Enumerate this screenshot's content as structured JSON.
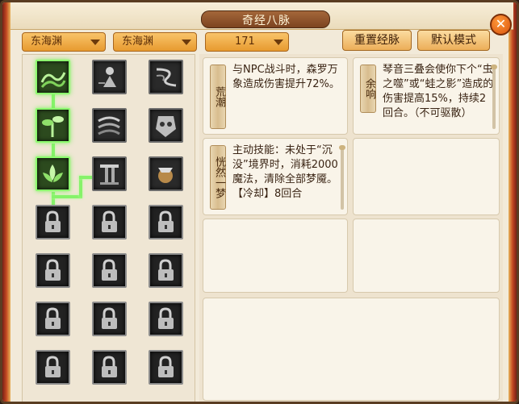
{
  "window": {
    "title": "奇经八脉"
  },
  "controls": {
    "dropdown1": "东海渊",
    "dropdown2": "东海渊",
    "dropdown3": "171",
    "reset_button": "重置经脉",
    "default_button": "默认模式",
    "close_icon": "close-icon"
  },
  "skills": [
    {
      "name": "荒潮",
      "desc": "与NPC战斗时，森罗万象造成伤害提升72%。"
    },
    {
      "name": "余响",
      "desc": "琴音三叠会使你下个“虫之噬”或“蛙之影”造成的伤害提高15%，持续2回合。（不可驱散）"
    },
    {
      "name": "恍然一梦",
      "desc": "主动技能：未处于“沉没”境界时，消耗2000魔法，清除全部梦魇。【冷却】8回合"
    }
  ],
  "grid_icons": [
    [
      "wave-icon",
      "figure-icon",
      "swirl-icon"
    ],
    [
      "plant-icon",
      "wind-icon",
      "mask-icon"
    ],
    [
      "lotus-icon",
      "pillar-icon",
      "hand-icon"
    ],
    [
      "lock-icon",
      "lock-icon",
      "lock-icon"
    ],
    [
      "lock-icon",
      "lock-icon",
      "lock-icon"
    ],
    [
      "lock-icon",
      "lock-icon",
      "lock-icon"
    ],
    [
      "lock-icon",
      "lock-icon",
      "lock-icon"
    ]
  ]
}
